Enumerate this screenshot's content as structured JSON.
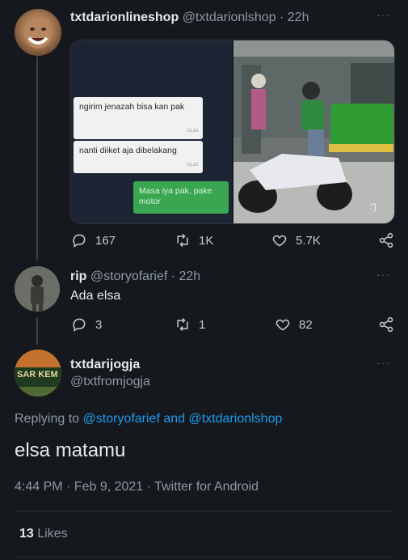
{
  "tweet1": {
    "display_name": "txtdarionlineshop",
    "handle_time": "@txtdarionlshop · 22h",
    "media_chat": {
      "msg1": "ngirim jenazah bisa kan pak",
      "msg1_time": "13.23",
      "msg2": "nanti diiket aja dibelakang",
      "msg2_time": "13.23",
      "msg3": "Masa iya pak, pake motor"
    },
    "photo_watermark": ":')",
    "stats": {
      "replies": "167",
      "retweets": "1K",
      "likes": "5.7K"
    }
  },
  "tweet2": {
    "display_name": "rip",
    "handle_time": "@storyofarief · 22h",
    "text": "Ada elsa",
    "stats": {
      "replies": "3",
      "retweets": "1",
      "likes": "82"
    }
  },
  "main_tweet": {
    "display_name": "txtdarijogja",
    "handle": "@txtfromjogja",
    "avatar_sign_text": "SAR KEM",
    "replying_prefix": "Replying to",
    "reply_user1": "@storyofarief",
    "reply_and": "and",
    "reply_user2": "@txtdarionlshop",
    "text": "elsa matamu",
    "meta": "4:44 PM · Feb 9, 2021 · Twitter for Android",
    "likes_count": "13",
    "likes_label": "Likes"
  },
  "colors": {
    "background": "#15181c",
    "link": "#1d9bf0",
    "muted": "#8b98a5"
  }
}
